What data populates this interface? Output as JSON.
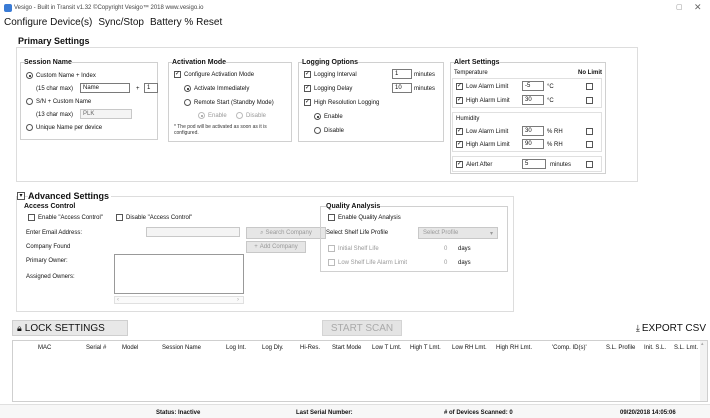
{
  "window": {
    "title": "Vesigo - Built in Transit    v1.32    ©Copyright Vesigo™ 2018 www.vesigo.io"
  },
  "menu": {
    "configure": "Configure Device(s)",
    "sync_stop": "Sync/Stop",
    "battery_reset": "Battery % Reset"
  },
  "primary": {
    "title": "Primary Settings",
    "session": {
      "title": "Session Name",
      "custom_index_label": "Custom Name + Index",
      "char_max_1": "(15 char max)",
      "name_value": "Name",
      "plus": "+",
      "index_value": "1",
      "sn_custom_label": "S/N + Custom Name",
      "char_max_2": "(13 char max)",
      "plk_value": "PLK",
      "unique_label": "Unique Name per device"
    },
    "activation": {
      "title": "Activation Mode",
      "configure_label": "Configure Activation Mode",
      "immediately_label": "Activate Immediately",
      "remote_label": "Remote Start (Standby Mode)",
      "enable_label": "Enable",
      "disable_label": "Disable",
      "note": "* The pod will be activated as soon as it is configured."
    },
    "logging": {
      "title": "Logging Options",
      "interval_label": "Logging Interval",
      "interval_value": "1",
      "interval_unit": "minutes",
      "delay_label": "Logging Delay",
      "delay_value": "10",
      "delay_unit": "minutes",
      "high_res_label": "High Resolution Logging",
      "enable_label": "Enable",
      "disable_label": "Disable"
    },
    "alert": {
      "title": "Alert Settings",
      "temperature": "Temperature",
      "no_limit": "No Limit",
      "low_temp_label": "Low Alarm Limit",
      "low_temp_value": "-5",
      "temp_unit_1": "°C",
      "high_temp_label": "High Alarm Limit",
      "high_temp_value": "30",
      "temp_unit_2": "°C",
      "humidity": "Humidity",
      "low_rh_label": "Low Alarm Limit",
      "low_rh_value": "30",
      "rh_unit_1": "% RH",
      "high_rh_label": "High Alarm Limit",
      "high_rh_value": "90",
      "rh_unit_2": "% RH",
      "after_label": "Alert After",
      "after_value": "5",
      "after_unit": "minutes"
    }
  },
  "advanced": {
    "title": "Advanced Settings",
    "access": {
      "title": "Access Control",
      "enable_label": "Enable \"Access Control\"",
      "disable_label": "Disable \"Access Control\"",
      "email_label": "Enter Email Address:",
      "search_button": "Search Company",
      "company_label": "Company Found",
      "add_button": "Add Company",
      "primary_owner": "Primary Owner:",
      "assigned_owners": "Assigned Owners:"
    },
    "quality": {
      "title": "Quality Analysis",
      "enable_label": "Enable Quality Analysis",
      "select_label": "Select Shelf Life Profile",
      "select_value": "Select Profile",
      "initial_label": "Initial Shelf Life",
      "initial_value": "0",
      "initial_unit": "days",
      "alarm_label": "Low Shelf Life Alarm Limit",
      "alarm_value": "0",
      "alarm_unit": "days"
    }
  },
  "actions": {
    "lock": "LOCK SETTINGS",
    "start_scan": "START SCAN",
    "export": "EXPORT CSV"
  },
  "table": {
    "columns": [
      "MAC",
      "Serial #",
      "Model",
      "Session Name",
      "Log Int.",
      "Log Dly.",
      "Hi-Res.",
      "Start Mode",
      "Low T Lmt.",
      "High T Lmt.",
      "Low RH Lmt.",
      "High RH Lmt.",
      "'Comp. ID(s)'",
      "S.L. Profile",
      "Init. S.L.",
      "S.L. Lmt."
    ],
    "rows": []
  },
  "status": {
    "status": "Status: Inactive",
    "last_serial": "Last Serial Number:",
    "devices_scanned": "# of Devices Scanned: 0",
    "datetime": "09/20/2018 14:05:06"
  },
  "colors": {
    "accent": "#3a7bd5",
    "background": "#ffffff",
    "disabled_text": "#999999"
  }
}
